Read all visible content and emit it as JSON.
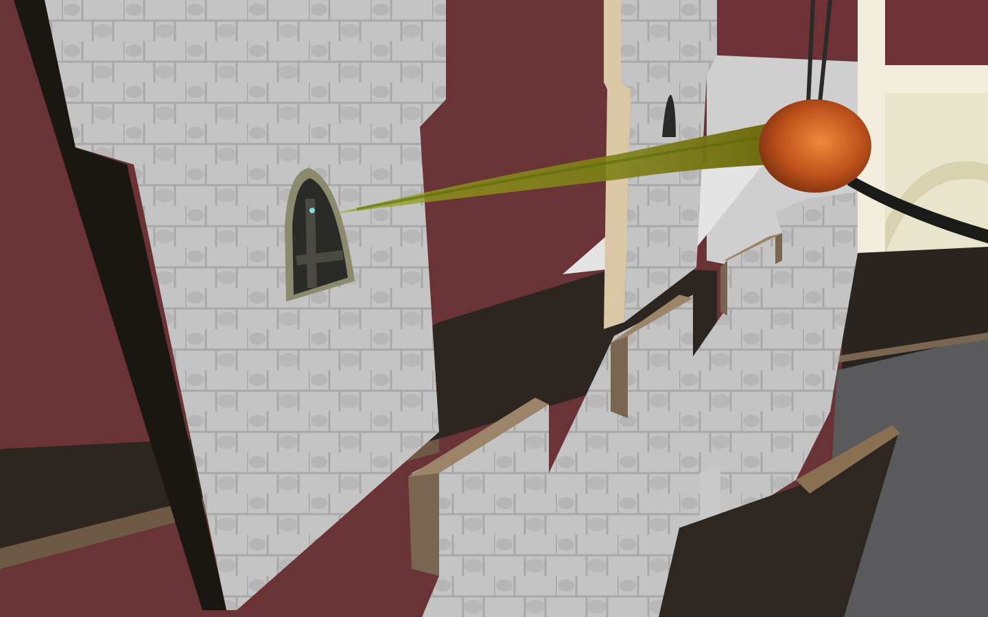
{
  "scene": {
    "description_visible_text": "",
    "colors": {
      "back_wall": "#6a3336",
      "wall_stone": "#bdbdbd",
      "wall_stone_dark": "#8e8e8e",
      "trim_wood": "#7a6650",
      "floor_dark": "#2c2520",
      "floor_grey": "#555558",
      "ceiling_cream": "#e8e2c8",
      "window_dark": "#2a2a28",
      "window_frame": "#8b8a6e",
      "projectile_head": "#c8581e",
      "projectile_trail": "#7a8a10",
      "tether": "#1a1a18"
    },
    "objects": [
      "castle-tower-left",
      "castle-tower-right",
      "crenellated-wall",
      "arched-window",
      "fireball-projectile",
      "green-energy-trail",
      "tether-rope",
      "back-room-arch",
      "wooden-floor-beam"
    ]
  }
}
